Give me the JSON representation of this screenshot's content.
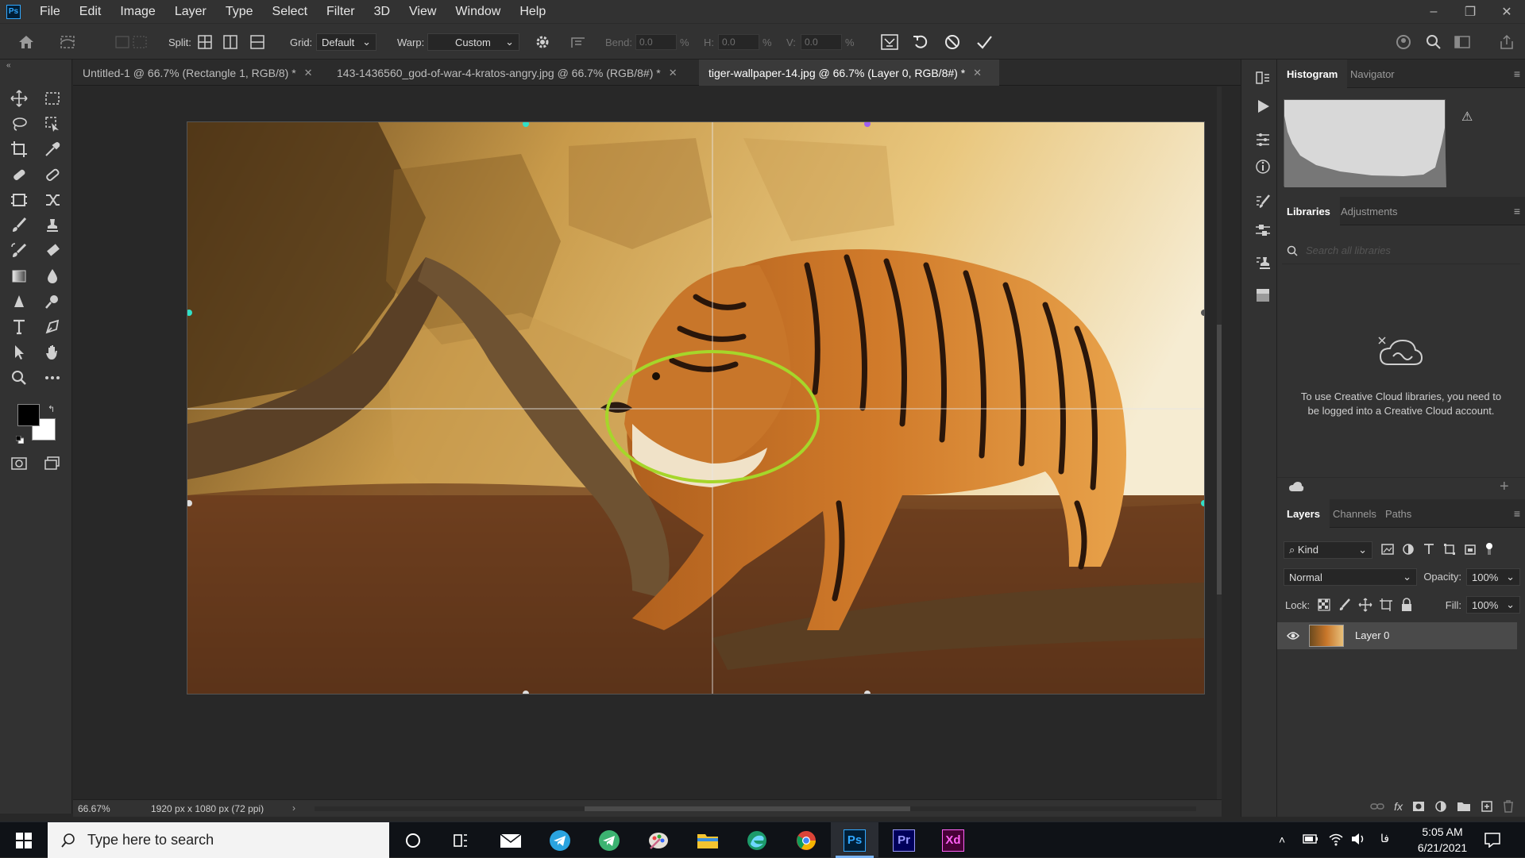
{
  "app": {
    "logo_text": "Ps"
  },
  "menu": [
    "File",
    "Edit",
    "Image",
    "Layer",
    "Type",
    "Select",
    "Filter",
    "3D",
    "View",
    "Window",
    "Help"
  ],
  "window_controls": {
    "minimize": "–",
    "restore": "❐",
    "close": "✕"
  },
  "options_bar": {
    "split_label": "Split:",
    "grid_label": "Grid:",
    "grid_value": "Default",
    "warp_label": "Warp:",
    "warp_value": "Custom",
    "bend_label": "Bend:",
    "bend_value": "0.0",
    "h_label": "H:",
    "h_value": "0.0",
    "v_label": "V:",
    "v_value": "0.0",
    "percent": "%"
  },
  "doc_tabs": [
    {
      "title": "Untitled-1 @ 66.7% (Rectangle 1, RGB/8) *",
      "close": "✕"
    },
    {
      "title": "143-1436560_god-of-war-4-kratos-angry.jpg @ 66.7% (RGB/8#) *",
      "close": "✕"
    },
    {
      "title": "tiger-wallpaper-14.jpg @ 66.7% (Layer 0, RGB/8#) *",
      "close": "✕"
    }
  ],
  "status": {
    "zoom": "66.67%",
    "doc_size": "1920 px x 1080 px (72 ppi)",
    "arrow": "›"
  },
  "histogram_panel": {
    "tabs": [
      "Histogram",
      "Navigator"
    ],
    "warning": "⚠"
  },
  "libraries_panel": {
    "tabs": [
      "Libraries",
      "Adjustments"
    ],
    "search_placeholder": "Search all libraries",
    "message": "To use Creative Cloud libraries, you need to be logged into a Creative Cloud account."
  },
  "layers_panel": {
    "tabs": [
      "Layers",
      "Channels",
      "Paths"
    ],
    "filter_kind": "Kind",
    "blend_mode": "Normal",
    "opacity_label": "Opacity:",
    "opacity_value": "100%",
    "lock_label": "Lock:",
    "fill_label": "Fill:",
    "fill_value": "100%",
    "layers": [
      {
        "name": "Layer 0",
        "visible": true
      }
    ]
  },
  "taskbar": {
    "search_placeholder": "Type here to search",
    "ps": "Ps",
    "pr": "Pr",
    "xd": "Xd",
    "ime": "فا",
    "time": "5:05 AM",
    "date": "6/21/2021"
  },
  "colors": {
    "accent": "#31a8ff",
    "warp_ellipse": "#a6d62a",
    "canvas_bg": "#282828",
    "panel_bg": "#323232"
  }
}
